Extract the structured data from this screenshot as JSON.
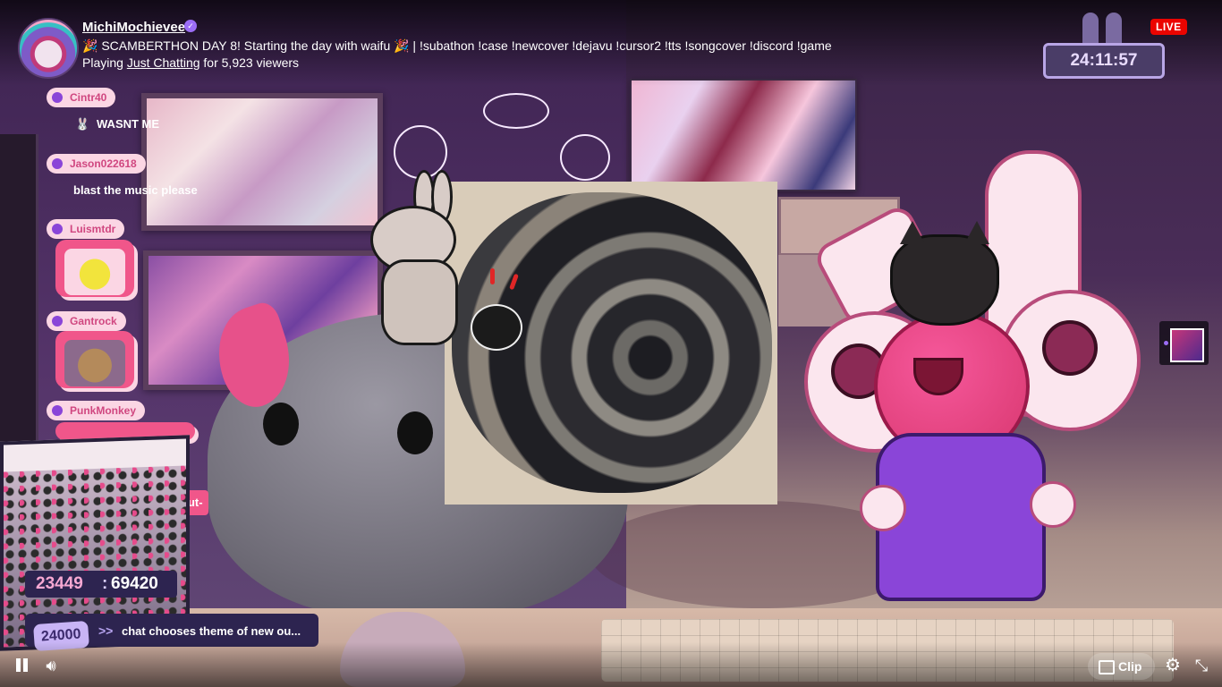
{
  "stream": {
    "streamer_name": "MichiMochievee",
    "title": "🎉 SCAMBERTHON DAY 8! Starting the day with waifu 🎉 | !subathon !case !newcover !dejavu !cursor2 !tts !songcover !discord !game",
    "playing_prefix": "Playing",
    "category": "Just Chatting",
    "viewers_text": "for 5,923 viewers",
    "live_label": "LIVE",
    "timer": "24:11:57"
  },
  "chat": [
    {
      "user": "Cintr40",
      "message": "WASNT ME"
    },
    {
      "user": "Jason022618",
      "message": "blast the music please"
    },
    {
      "user": "Luismtdr",
      "message": ""
    },
    {
      "user": "Gantrock",
      "message": ""
    },
    {
      "user": "PunkMonkey",
      "message": ""
    }
  ],
  "goals": {
    "current": "23449",
    "separator": ":",
    "target": "69420",
    "partial_label": "out-",
    "next_value": "24000",
    "next_arrow": ">>",
    "next_text": "chat chooses theme of new ou..."
  },
  "controls": {
    "pause_icon": "pause-icon",
    "volume_icon": "volume-icon",
    "clip_label": "Clip",
    "settings_icon": "gear-icon",
    "fullscreen_icon": "exit-fullscreen-icon"
  },
  "colors": {
    "live_red": "#eb0400",
    "chat_pink": "#f0568a",
    "goal_panel": "#2d2450",
    "accent_purple": "#9b6df5"
  }
}
